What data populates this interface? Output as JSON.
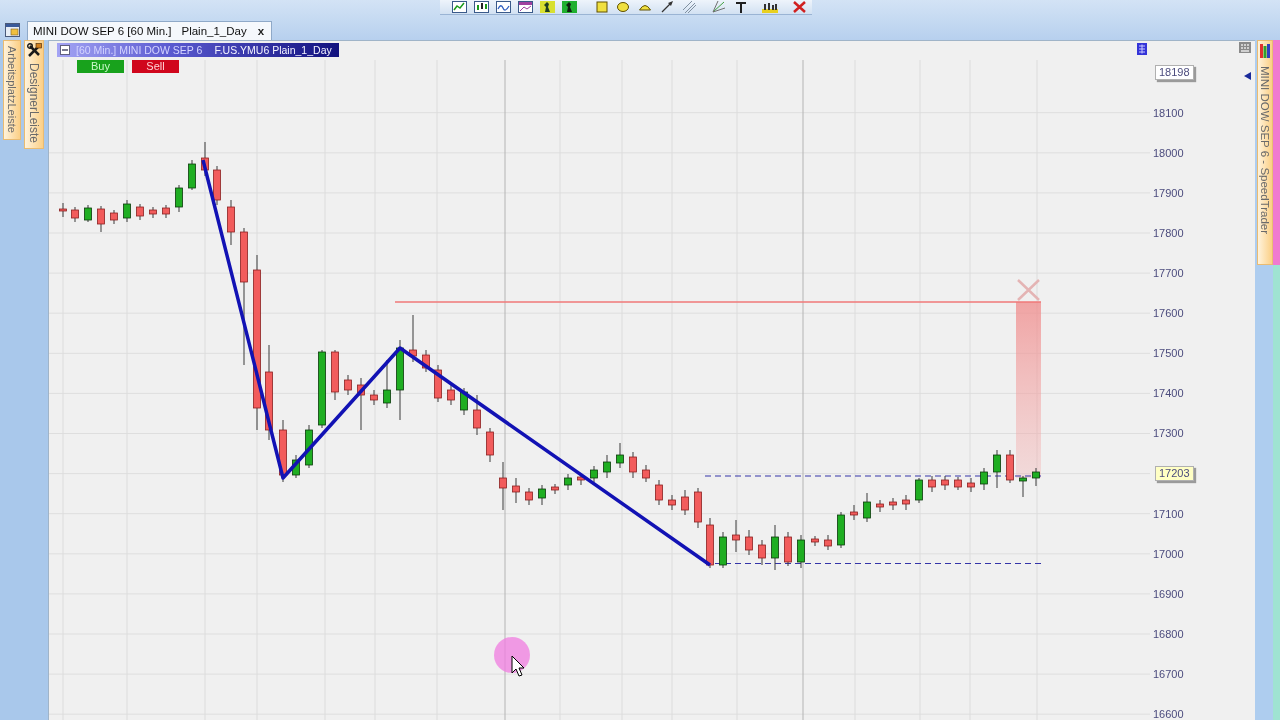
{
  "document_tabs": [
    {
      "title": "MINI DOW SEP 6 [60 Min.]",
      "template": "Plain_1_Day",
      "close": "x",
      "selected": true
    }
  ],
  "side_tabs": [
    {
      "label": "ArbeitsplatzLeiste",
      "kind": "plain"
    },
    {
      "label": "DesignerLeiste",
      "kind": "tools"
    }
  ],
  "chart": {
    "title": "[60 Min.] MINI DOW SEP 6",
    "instrument": "F.US.YMU6 Plain_1_Day",
    "order_buttons": [
      {
        "label": "Buy",
        "kind": "buy"
      },
      {
        "label": "Sell",
        "kind": "sell"
      }
    ],
    "price_axis": [
      {
        "label": "18198",
        "kind": "high_tag"
      },
      {
        "label": "18100",
        "kind": "tick"
      },
      {
        "label": "18000",
        "kind": "tick"
      },
      {
        "label": "17900",
        "kind": "tick"
      },
      {
        "label": "17800",
        "kind": "tick"
      },
      {
        "label": "17700",
        "kind": "tick"
      },
      {
        "label": "17600",
        "kind": "tick"
      },
      {
        "label": "17500",
        "kind": "tick"
      },
      {
        "label": "17400",
        "kind": "tick"
      },
      {
        "label": "17300",
        "kind": "tick"
      },
      {
        "label": "17203",
        "kind": "last_tag"
      },
      {
        "label": "17100",
        "kind": "tick"
      },
      {
        "label": "17000",
        "kind": "tick"
      },
      {
        "label": "16900",
        "kind": "tick"
      },
      {
        "label": "16800",
        "kind": "tick"
      },
      {
        "label": "16700",
        "kind": "tick"
      },
      {
        "label": "16600",
        "kind": "tick"
      }
    ]
  },
  "right_tab": {
    "label": "MINI DOW SEP 6 - SpeedTrader"
  }
}
